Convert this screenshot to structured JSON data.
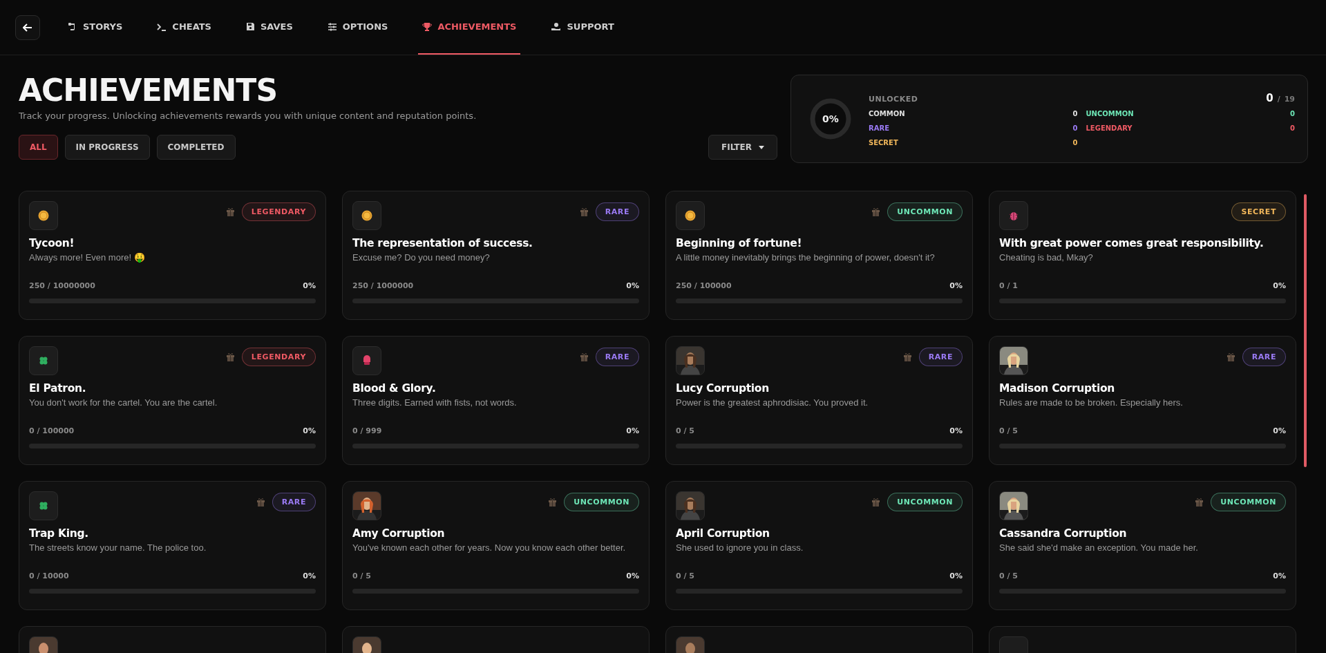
{
  "nav": {
    "tabs": [
      {
        "label": "STORYS",
        "kind": "scroll",
        "selected": false
      },
      {
        "label": "CHEATS",
        "kind": "terminal",
        "selected": false
      },
      {
        "label": "SAVES",
        "kind": "floppy",
        "selected": false
      },
      {
        "label": "OPTIONS",
        "kind": "sliders",
        "selected": false
      },
      {
        "label": "ACHIEVEMENTS",
        "kind": "trophy",
        "selected": true
      },
      {
        "label": "SUPPORT",
        "kind": "hand",
        "selected": false
      }
    ]
  },
  "header": {
    "title": "ACHIEVEMENTS",
    "subtitle": "Track your progress. Unlocking achievements rewards you with unique content and reputation points."
  },
  "filters": [
    {
      "label": "ALL",
      "selected": true
    },
    {
      "label": "IN PROGRESS",
      "selected": false
    },
    {
      "label": "COMPLETED",
      "selected": false
    }
  ],
  "filter_button": {
    "label": "FILTER"
  },
  "stats": {
    "percent": "0%",
    "level": 0,
    "label": "UNLOCKED",
    "count": "0",
    "separator": "/",
    "total": "19",
    "rarities": [
      {
        "name": "COMMON",
        "value": "0",
        "color": "#e0e0e0"
      },
      {
        "name": "UNCOMMON",
        "value": "0",
        "color": "#6ee7b7"
      },
      {
        "name": "RARE",
        "value": "0",
        "color": "#9b7bf5"
      },
      {
        "name": "LEGENDARY",
        "value": "0",
        "color": "#ef5a64"
      },
      {
        "name": "SECRET",
        "value": "0",
        "color": "#f0b65a"
      }
    ]
  },
  "cards": [
    {
      "kind": "coin",
      "title": "Tycoon!",
      "description": "Always more! Even more! 🤑",
      "badge": "LEGENDARY",
      "color": "#ef5a64",
      "reward": true,
      "progress": "250 / 10000000",
      "percent": "0%",
      "level": 0
    },
    {
      "kind": "coin",
      "title": "The representation of success.",
      "description": "Excuse me? Do you need money?",
      "badge": "RARE",
      "color": "#9b7bf5",
      "reward": true,
      "progress": "250 / 1000000",
      "percent": "0%",
      "level": 0
    },
    {
      "kind": "coin",
      "title": "Beginning of fortune!",
      "description": "A little money inevitably brings the beginning of power, doesn't it?",
      "badge": "UNCOMMON",
      "color": "#6ee7b7",
      "reward": true,
      "progress": "250 / 100000",
      "percent": "0%",
      "level": 0
    },
    {
      "kind": "bug",
      "title": "With great power comes great responsibility.",
      "description": "Cheating is bad, Mkay?",
      "badge": "SECRET",
      "color": "#f0b65a",
      "reward": false,
      "progress": "0 / 1",
      "percent": "0%",
      "level": 0
    },
    {
      "kind": "clover",
      "title": "El Patron.",
      "description": "You don't work for the cartel. You are the cartel.",
      "badge": "LEGENDARY",
      "color": "#ef5a64",
      "reward": true,
      "progress": "0 / 100000",
      "percent": "0%",
      "level": 0
    },
    {
      "kind": "glove",
      "title": "Blood & Glory.",
      "description": "Three digits. Earned with fists, not words.",
      "badge": "RARE",
      "color": "#9b7bf5",
      "reward": true,
      "progress": "0 / 999",
      "percent": "0%",
      "level": 0
    },
    {
      "kind": "picture",
      "title": "Lucy Corruption",
      "description": "Power is the greatest aphrodisiac. You proved it.",
      "badge": "RARE",
      "color": "#9b7bf5",
      "reward": true,
      "progress": "0 / 5",
      "percent": "0%",
      "level": 0
    },
    {
      "kind": "picture",
      "title": "Madison Corruption",
      "description": "Rules are made to be broken. Especially hers.",
      "badge": "RARE",
      "color": "#9b7bf5",
      "reward": true,
      "progress": "0 / 5",
      "percent": "0%",
      "level": 0
    },
    {
      "kind": "clover",
      "title": "Trap King.",
      "description": "The streets know your name. The police too.",
      "badge": "RARE",
      "color": "#9b7bf5",
      "reward": true,
      "progress": "0 / 10000",
      "percent": "0%",
      "level": 0
    },
    {
      "kind": "picture",
      "title": "Amy Corruption",
      "description": "You've known each other for years. Now you know each other better.",
      "badge": "UNCOMMON",
      "color": "#6ee7b7",
      "reward": true,
      "progress": "0 / 5",
      "percent": "0%",
      "level": 0
    },
    {
      "kind": "picture",
      "title": "April Corruption",
      "description": "She used to ignore you in class.",
      "badge": "UNCOMMON",
      "color": "#6ee7b7",
      "reward": true,
      "progress": "0 / 5",
      "percent": "0%",
      "level": 0
    },
    {
      "kind": "picture",
      "title": "Cassandra Corruption",
      "description": "She said she'd make an exception. You made her.",
      "badge": "UNCOMMON",
      "color": "#6ee7b7",
      "reward": true,
      "progress": "0 / 5",
      "percent": "0%",
      "level": 0
    }
  ],
  "partial_cards": [
    {
      "kind": "picture"
    },
    {
      "kind": "picture"
    },
    {
      "kind": "picture"
    },
    {
      "kind": "blank"
    }
  ]
}
